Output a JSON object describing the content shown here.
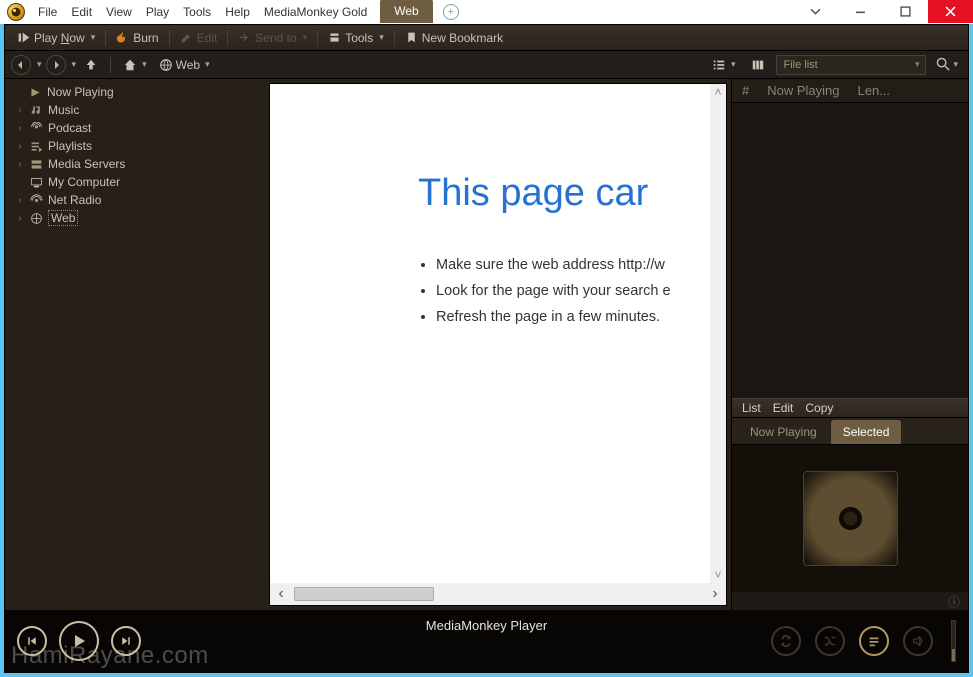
{
  "window": {
    "menus": [
      "File",
      "Edit",
      "View",
      "Play",
      "Tools",
      "Help",
      "MediaMonkey Gold"
    ],
    "active_tab": "Web"
  },
  "toolbar1": {
    "play_now": "Play Now",
    "burn": "Burn",
    "edit": "Edit",
    "send_to": "Send to",
    "tools": "Tools",
    "new_bookmark": "New Bookmark"
  },
  "toolbar2": {
    "crumb": "Web",
    "dropdown": "File list"
  },
  "tree": {
    "items": [
      {
        "label": "Now Playing",
        "icon": "now-playing",
        "expand": ""
      },
      {
        "label": "Music",
        "icon": "music",
        "expand": "›"
      },
      {
        "label": "Podcast",
        "icon": "podcast",
        "expand": "›"
      },
      {
        "label": "Playlists",
        "icon": "playlists",
        "expand": "›"
      },
      {
        "label": "Media Servers",
        "icon": "server",
        "expand": "›"
      },
      {
        "label": "My Computer",
        "icon": "computer",
        "expand": ""
      },
      {
        "label": "Net Radio",
        "icon": "radio",
        "expand": "›"
      },
      {
        "label": "Web",
        "icon": "web",
        "expand": "›",
        "selected": true
      }
    ]
  },
  "browser": {
    "heading": "This page car",
    "bullets": [
      "Make sure the web address http://w",
      "Look for the page with your search e",
      "Refresh the page in a few minutes."
    ]
  },
  "right": {
    "cols": [
      "#",
      "Now Playing",
      "Len..."
    ],
    "menu": [
      "List",
      "Edit",
      "Copy"
    ],
    "tabs": {
      "now_playing": "Now Playing",
      "selected": "Selected"
    }
  },
  "player": {
    "title": "MediaMonkey Player"
  },
  "watermark": "HamiRayane.com"
}
